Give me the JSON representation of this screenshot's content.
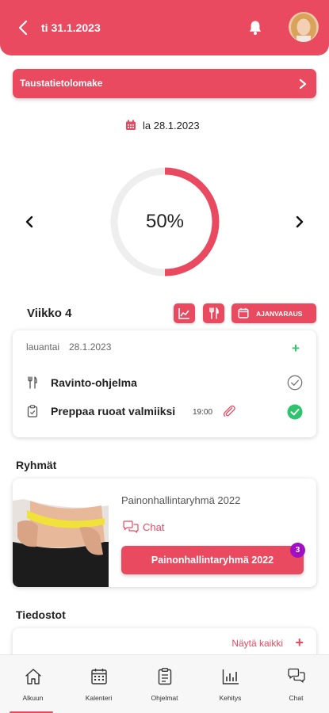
{
  "header": {
    "date": "ti 31.1.2023",
    "back_icon": "chevron-left-icon",
    "bell_icon": "bell-icon",
    "avatar_icon": "user-avatar"
  },
  "banner": {
    "label": "Taustatietolomake",
    "icon": "chevron-right-icon"
  },
  "progress": {
    "date": "la 28.1.2023",
    "percent_text": "50%",
    "value": 0.5,
    "color": "#ea4a5f",
    "track_color": "#eeeeee"
  },
  "week": {
    "label": "Viikko 4",
    "ajanvaraus_label": "AJANVARAUS"
  },
  "day": {
    "weekday": "lauantai",
    "date": "28.1.2023",
    "add": "+",
    "items": [
      {
        "title": "Ravinto-ohjelma",
        "icon": "fork-knife-icon",
        "status": "pending"
      },
      {
        "title": "Preppaa ruoat valmiiksi",
        "time": "19:00",
        "icon": "clipboard-icon",
        "status": "done"
      }
    ]
  },
  "groups": {
    "title": "Ryhmät",
    "card": {
      "name": "Painonhallintaryhmä 2022",
      "chat_label": "Chat",
      "button_label": "Painonhallintaryhmä 2022",
      "badge": "3"
    }
  },
  "files": {
    "title": "Tiedostot",
    "show_all": "Näytä kaikki",
    "add": "+"
  },
  "tabs": [
    {
      "label": "Alkuun",
      "icon": "home-icon",
      "active": true
    },
    {
      "label": "Kalenteri",
      "icon": "calendar-icon",
      "active": false
    },
    {
      "label": "Ohjelmat",
      "icon": "clipboard-icon",
      "active": false
    },
    {
      "label": "Kehitys",
      "icon": "bar-chart-icon",
      "active": false
    },
    {
      "label": "Chat",
      "icon": "chat-bubbles-icon",
      "active": false
    }
  ],
  "colors": {
    "accent": "#ea4a5f",
    "success": "#2ec46d",
    "badge": "#a10fc4"
  }
}
